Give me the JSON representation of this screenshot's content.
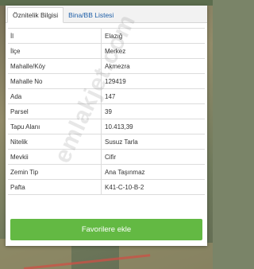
{
  "tabs": [
    {
      "label": "Öznitelik Bilgisi",
      "active": true
    },
    {
      "label": "Bina/BB Listesi",
      "active": false
    }
  ],
  "attributes": [
    {
      "label": "İl",
      "value": "Elazığ"
    },
    {
      "label": "İlçe",
      "value": "Merkez"
    },
    {
      "label": "Mahalle/Köy",
      "value": "Akmezra"
    },
    {
      "label": "Mahalle No",
      "value": "129419"
    },
    {
      "label": "Ada",
      "value": "147"
    },
    {
      "label": "Parsel",
      "value": "39"
    },
    {
      "label": "Tapu Alanı",
      "value": "10.413,39"
    },
    {
      "label": "Nitelik",
      "value": "Susuz Tarla"
    },
    {
      "label": "Mevkii",
      "value": "Cifir"
    },
    {
      "label": "Zemin Tip",
      "value": "Ana Taşınmaz"
    },
    {
      "label": "Pafta",
      "value": "K41-C-10-B-2"
    }
  ],
  "favorite_button_label": "Favorilere ekle",
  "watermark_text": "emlakjet.com",
  "colors": {
    "button_green": "#63b943",
    "tab_link_blue": "#1e5fa8",
    "map_road_red": "#cd5046"
  }
}
